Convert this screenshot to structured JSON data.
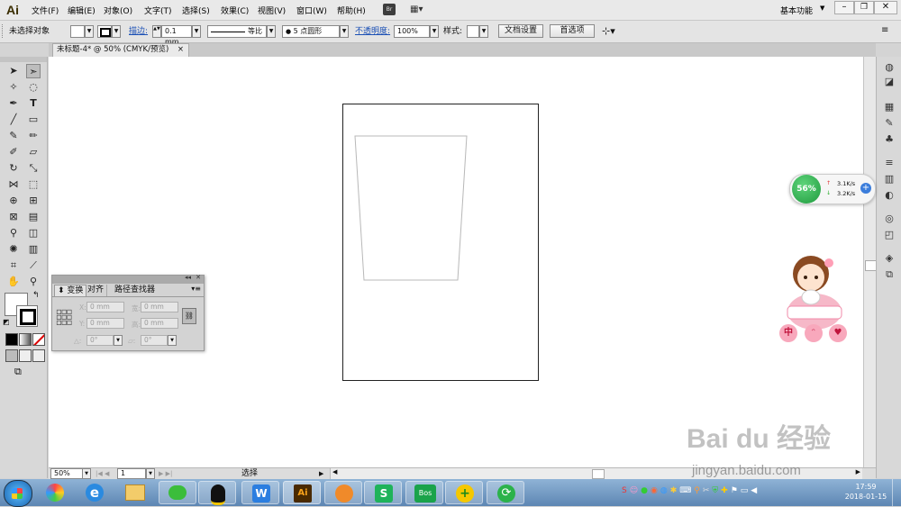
{
  "app": {
    "logo": "Ai",
    "workspace": "基本功能"
  },
  "menu": [
    "文件(F)",
    "编辑(E)",
    "对象(O)",
    "文字(T)",
    "选择(S)",
    "效果(C)",
    "视图(V)",
    "窗口(W)",
    "帮助(H)"
  ],
  "menubar_icons": {
    "bridge": "Br"
  },
  "control_bar": {
    "selection_label": "未选择对象",
    "stroke_label": "描边:",
    "stroke_weight": "0.1 mm",
    "stroke_profile": "等比",
    "brush": "5 点圆形",
    "opacity_label": "不透明度:",
    "opacity_value": "100%",
    "style_label": "样式:",
    "doc_setup": "文档设置",
    "preferences": "首选项"
  },
  "document_tab": {
    "title": "未标题-4* @ 50% (CMYK/预览)",
    "close": "×"
  },
  "transform_panel": {
    "tabs": [
      "变换",
      "对齐",
      "路径查找器"
    ],
    "fields": {
      "x_label": "X:",
      "x_value": "0 mm",
      "w_label": "宽:",
      "w_value": "0 mm",
      "y_label": "Y:",
      "y_value": "0 mm",
      "h_label": "高:",
      "h_value": "0 mm",
      "rot_label": "△:",
      "rot_value": "0°",
      "shear_label": "▱:",
      "shear_value": "0°"
    }
  },
  "status_bar": {
    "zoom": "50%",
    "page": "1",
    "tool": "选择"
  },
  "net_monitor": {
    "percent": "56%",
    "up": "3.1K/s",
    "down": "3.2K/s"
  },
  "mascot_chars": [
    "中",
    "ᵔ",
    "♥"
  ],
  "watermark": {
    "brand": "Bai du 经验",
    "url": "jingyan.baidu.com"
  },
  "clock": {
    "time": "17:59",
    "date": "2018-01-15"
  },
  "colors": {
    "artboard_border": "#222222",
    "shape_stroke": "#b8b8b8",
    "net_green": "#2aa84a"
  }
}
